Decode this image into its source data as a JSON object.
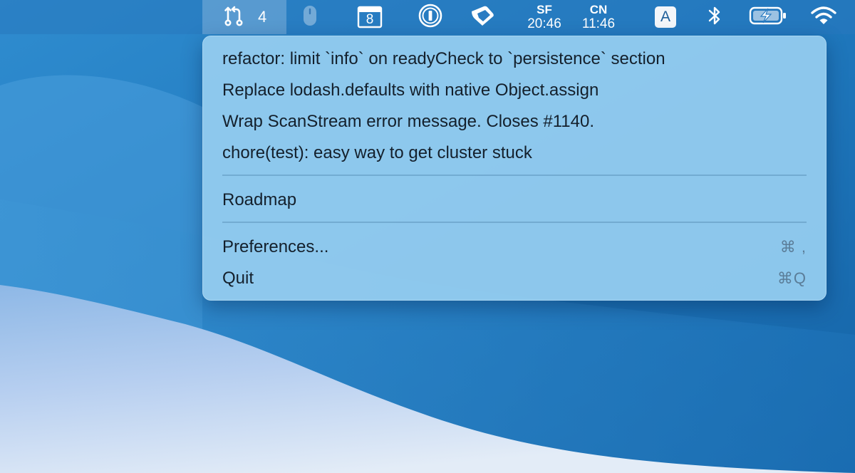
{
  "menubar": {
    "pull_requests": {
      "icon": "git-pull-request-icon",
      "count": "4"
    },
    "status_icons": [
      "mouse-icon",
      "calendar-icon",
      "password-manager-icon",
      "tag-icon"
    ],
    "calendar_day": "8",
    "clocks": [
      {
        "city": "SF",
        "time": "20:46"
      },
      {
        "city": "CN",
        "time": "11:46"
      }
    ],
    "input_source": "A",
    "right_icons": [
      "bluetooth-icon",
      "battery-charging-icon",
      "wifi-icon"
    ]
  },
  "menu": {
    "pull_requests": [
      "refactor: limit `info` on readyCheck to `persistence` section",
      "Replace lodash.defaults with native Object.assign",
      "Wrap ScanStream error message. Closes #1140.",
      "chore(test): easy way to get cluster stuck"
    ],
    "roadmap": "Roadmap",
    "preferences": {
      "label": "Preferences...",
      "shortcut": "⌘ ,"
    },
    "quit": {
      "label": "Quit",
      "shortcut": "⌘Q"
    }
  },
  "colors": {
    "menubar_bg": "#2878be",
    "menu_bg": "#96cdf0",
    "desktop_dark": "#1a6fb4",
    "desktop_light": "#c8dcf2"
  }
}
